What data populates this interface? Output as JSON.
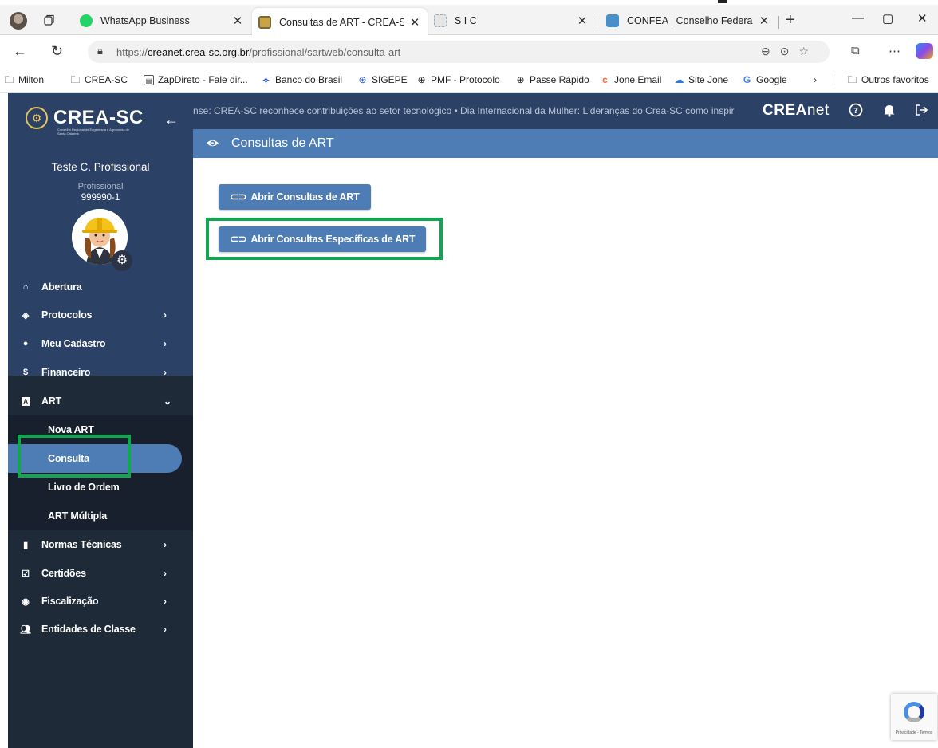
{
  "browser": {
    "tabs": [
      {
        "title": "WhatsApp Business",
        "color": "#25d366"
      },
      {
        "title": "Consultas de ART - CREA-SC",
        "color": "#c9a24a"
      },
      {
        "title": "S I C",
        "color": "#d8d8d8"
      },
      {
        "title": "CONFEA | Conselho Federal de",
        "color": "#4a90c8"
      }
    ],
    "url_prefix": "https://",
    "url_domain": "creanet.crea-sc.org.br",
    "url_path": "/profissional/sartweb/consulta-art",
    "favorites": [
      {
        "label": "Milton",
        "icon": "folder-icon"
      },
      {
        "label": "CREA-SC",
        "icon": "folder-icon"
      },
      {
        "label": "ZapDireto - Fale dir...",
        "icon": "zapdireto-icon"
      },
      {
        "label": "Banco do Brasil",
        "icon": "banco-do-brasil-icon"
      },
      {
        "label": "SIGEPE",
        "icon": "sigepe-icon"
      },
      {
        "label": "PMF - Protocolo",
        "icon": "globe-icon"
      },
      {
        "label": "Passe Rápido",
        "icon": "globe-icon"
      },
      {
        "label": "Jone Email",
        "icon": "cpanel-icon"
      },
      {
        "label": "Site Jone",
        "icon": "cloud-icon"
      },
      {
        "label": "Google",
        "icon": "google-icon"
      }
    ],
    "other_favorites": "Outros favoritos"
  },
  "sidebar": {
    "logo_text": "CREA-SC",
    "logo_subtitle": "Conselho Regional de Engenharia e Agronomia de Santa Catarina",
    "user_name": "Teste C. Profissional",
    "user_role": "Profissional",
    "user_id": "999990-1",
    "menu": [
      {
        "label": "Abertura",
        "icon": "home-icon"
      },
      {
        "label": "Protocolos",
        "icon": "layers-icon"
      },
      {
        "label": "Meu Cadastro",
        "icon": "user-icon"
      },
      {
        "label": "Financeiro",
        "icon": "dollar-icon"
      },
      {
        "label": "ART",
        "icon": "art-icon"
      }
    ],
    "art_submenu": [
      "Nova ART",
      "Consulta",
      "Livro de Ordem",
      "ART Múltipla"
    ],
    "menu_bottom": [
      {
        "label": "Normas Técnicas",
        "icon": "file-icon"
      },
      {
        "label": "Certidões",
        "icon": "check-square-icon"
      },
      {
        "label": "Fiscalização",
        "icon": "compass-icon"
      },
      {
        "label": "Entidades de Classe",
        "icon": "users-icon"
      }
    ]
  },
  "header": {
    "ticker": "nse: CREA-SC reconhece contribuições ao setor tecnológico • Dia Internacional da Mulher: Lideranças do Crea-SC como inspir",
    "brand_bold": "CREA",
    "brand_light": "net"
  },
  "page": {
    "title": "Consultas de ART",
    "buttons": [
      "Abrir Consultas de ART",
      "Abrir Consultas Específicas de ART"
    ]
  },
  "recaptcha": {
    "text": "Privacidade - Termos"
  },
  "colors": {
    "sidebar": "#1f2a38",
    "sidebar_header": "#2b4166",
    "accent": "#4e7db5",
    "highlight": "#13a650"
  }
}
